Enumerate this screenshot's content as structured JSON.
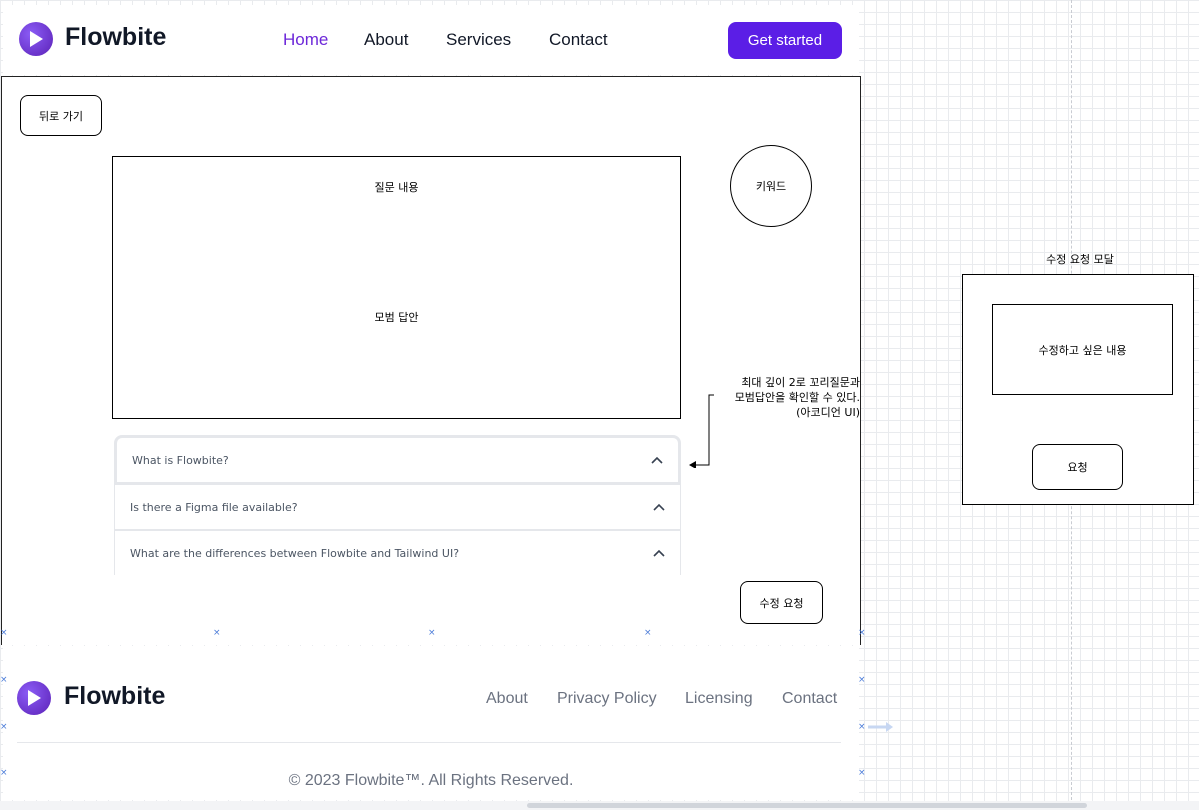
{
  "navbar": {
    "brand": "Flowbite",
    "links": [
      "Home",
      "About",
      "Services",
      "Contact"
    ],
    "cta": "Get started",
    "accent": "#5b1ee6"
  },
  "page": {
    "back_label": "뒤로 가기",
    "question_label": "질문 내용",
    "answer_label": "모범 답안",
    "keyword_label": "키워드",
    "annotation_lines": [
      "최대 깊이 2로 꼬리질문과",
      "모범답안을 확인할 수 있다.",
      "(아코디언 UI)"
    ],
    "accordion": [
      "What is Flowbite?",
      "Is there a Figma file available?",
      "What are the differences between Flowbite and Tailwind UI?"
    ],
    "edit_label": "수정 요청"
  },
  "footer": {
    "brand": "Flowbite",
    "links": [
      "About",
      "Privacy Policy",
      "Licensing",
      "Contact"
    ],
    "copyright": "© 2023 Flowbite™. All Rights Reserved."
  },
  "modal": {
    "title": "수정 요청 모달",
    "content_label": "수정하고 싶은 내용",
    "submit_label": "요청"
  },
  "icons": {
    "logo": "play-logo-icon",
    "accordion": "chevron-up-icon",
    "marker": "x-marker-icon"
  }
}
